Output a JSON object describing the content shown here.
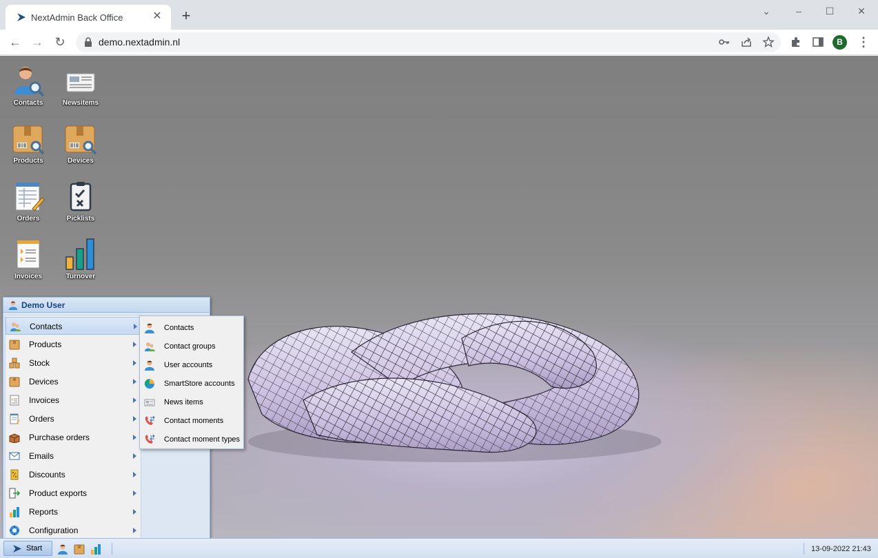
{
  "browser": {
    "tab_title": "NextAdmin Back Office",
    "url": "demo.nextadmin.nl",
    "profile_initial": "B"
  },
  "desktop_icons": [
    {
      "label": "Contacts",
      "icon": "contacts-icon"
    },
    {
      "label": "Newsitems",
      "icon": "newsitems-icon"
    },
    {
      "label": "Products",
      "icon": "products-icon"
    },
    {
      "label": "Devices",
      "icon": "devices-icon"
    },
    {
      "label": "Orders",
      "icon": "orders-icon"
    },
    {
      "label": "Picklists",
      "icon": "picklists-icon"
    },
    {
      "label": "Invoices",
      "icon": "invoices-icon"
    },
    {
      "label": "Turnover",
      "icon": "turnover-icon"
    }
  ],
  "start_menu": {
    "user": "Demo User",
    "items": [
      {
        "label": "Contacts",
        "icon": "contacts-icon",
        "active": true
      },
      {
        "label": "Products",
        "icon": "products-icon"
      },
      {
        "label": "Stock",
        "icon": "stock-icon"
      },
      {
        "label": "Devices",
        "icon": "devices-icon"
      },
      {
        "label": "Invoices",
        "icon": "invoices-icon"
      },
      {
        "label": "Orders",
        "icon": "orders-icon"
      },
      {
        "label": "Purchase orders",
        "icon": "purchase-orders-icon"
      },
      {
        "label": "Emails",
        "icon": "email-icon"
      },
      {
        "label": "Discounts",
        "icon": "discounts-icon"
      },
      {
        "label": "Product exports",
        "icon": "export-icon"
      },
      {
        "label": "Reports",
        "icon": "reports-icon"
      },
      {
        "label": "Configuration",
        "icon": "configuration-icon"
      }
    ]
  },
  "submenu": {
    "items": [
      {
        "label": "Contacts",
        "icon": "contact-icon"
      },
      {
        "label": "Contact groups",
        "icon": "contact-groups-icon"
      },
      {
        "label": "User accounts",
        "icon": "user-account-icon"
      },
      {
        "label": "SmartStore accounts",
        "icon": "smartstore-icon"
      },
      {
        "label": "News items",
        "icon": "news-icon"
      },
      {
        "label": "Contact moments",
        "icon": "contact-moment-icon"
      },
      {
        "label": "Contact moment types",
        "icon": "contact-moment-type-icon"
      }
    ]
  },
  "taskbar": {
    "start_label": "Start",
    "clock": "13-09-2022 21:43"
  },
  "colors": {
    "accent": "#15428b",
    "menu_bg": "#dde7f3",
    "taskbar": "#d2e0f1"
  }
}
